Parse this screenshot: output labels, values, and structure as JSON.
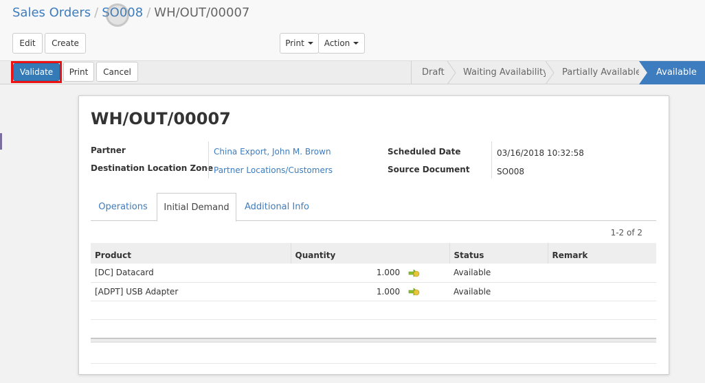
{
  "breadcrumb": {
    "item1": "Sales Orders",
    "item2": "SO008",
    "current": "WH/OUT/00007"
  },
  "toolbar": {
    "edit": "Edit",
    "create": "Create",
    "print": "Print",
    "action": "Action"
  },
  "statusbar": {
    "validate": "Validate",
    "print": "Print",
    "cancel": "Cancel",
    "stages": [
      "Draft",
      "Waiting Availability",
      "Partially Available",
      "Available"
    ],
    "active_stage": "Available"
  },
  "form": {
    "title": "WH/OUT/00007",
    "partner_label": "Partner",
    "partner_value": "China Export, John M. Brown",
    "dest_label": "Destination Location Zone",
    "dest_value": "Partner Locations/Customers",
    "sched_label": "Scheduled Date",
    "sched_value": "03/16/2018 10:32:58",
    "source_label": "Source Document",
    "source_value": "SO008"
  },
  "tabs": [
    "Operations",
    "Initial Demand",
    "Additional Info"
  ],
  "active_tab": "Initial Demand",
  "pager": "1-2 of 2",
  "table": {
    "headers": [
      "Product",
      "Quantity",
      "Status",
      "Remark"
    ],
    "rows": [
      {
        "product": "[DC] Datacard",
        "quantity": "1.000",
        "status": "Available",
        "remark": ""
      },
      {
        "product": "[ADPT] USB Adapter",
        "quantity": "1.000",
        "status": "Available",
        "remark": ""
      }
    ]
  },
  "colors": {
    "accent": "#3c7cbf",
    "highlight": "#ee1111"
  },
  "icons": {
    "row_status": "forecast-arrow-icon"
  }
}
